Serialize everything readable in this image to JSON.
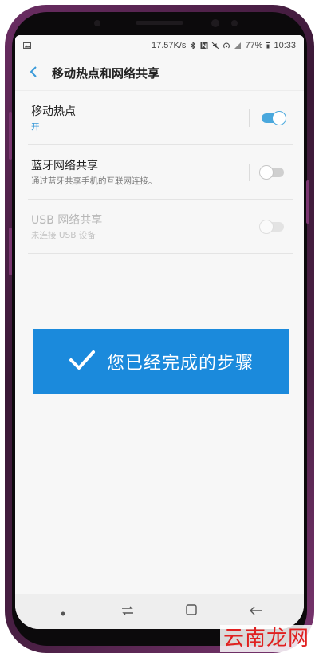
{
  "status_bar": {
    "speed": "17.57K/s",
    "battery": "77%",
    "time": "10:33"
  },
  "header": {
    "title": "移动热点和网络共享"
  },
  "rows": [
    {
      "title": "移动热点",
      "subtitle": "开",
      "toggle": "on",
      "enabled": true
    },
    {
      "title": "蓝牙网络共享",
      "subtitle": "通过蓝牙共享手机的互联网连接。",
      "toggle": "off",
      "enabled": true
    },
    {
      "title": "USB 网络共享",
      "subtitle": "未连接 USB 设备",
      "toggle": "off",
      "enabled": false
    }
  ],
  "banner": {
    "text": "您已经完成的步骤",
    "icon": "checkmark-icon",
    "color": "#1b8adc"
  },
  "nav": {
    "icons": [
      "dot-icon",
      "recent-apps-icon",
      "home-icon",
      "back-arrow-icon"
    ]
  },
  "watermark": {
    "text": "云南龙网",
    "color": "#e02020"
  },
  "colors": {
    "accent": "#4aa8dd",
    "frame": "#6b2d63"
  }
}
